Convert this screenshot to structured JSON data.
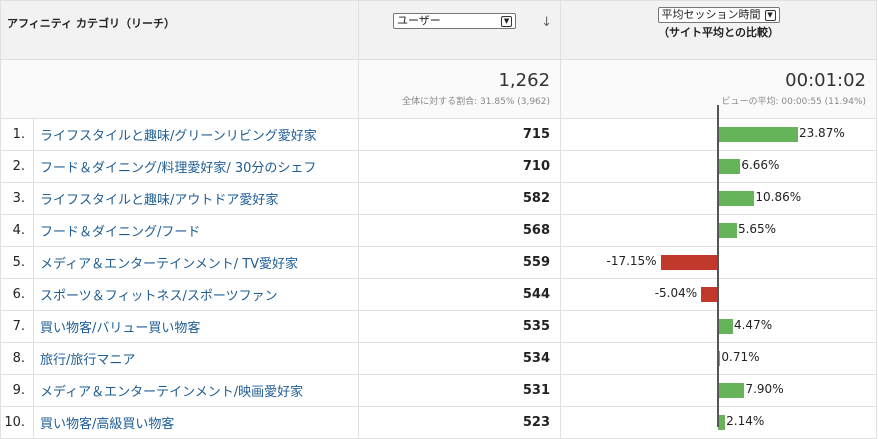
{
  "header": {
    "dimension": "アフィニティ カテゴリ（リーチ）",
    "users_select": "ユーザー",
    "sort_icon": "down-arrow-icon",
    "metric_select": "平均セッション時間",
    "compare_note": "（サイト平均との比較）"
  },
  "totals": {
    "users": "1,262",
    "users_note": "全体に対する割合: 31.85% (3,962)",
    "metric": "00:01:02",
    "metric_note": "ビューの平均: 00:00:55 (11.94%)"
  },
  "rows": [
    {
      "idx": "1.",
      "name": "ライフスタイルと趣味/グリーンリビング愛好家",
      "users": "715",
      "pct": "23.87%",
      "value": 23.87
    },
    {
      "idx": "2.",
      "name": "フード＆ダイニング/料理愛好家/ 30分のシェフ",
      "users": "710",
      "pct": "6.66%",
      "value": 6.66
    },
    {
      "idx": "3.",
      "name": "ライフスタイルと趣味/アウトドア愛好家",
      "users": "582",
      "pct": "10.86%",
      "value": 10.86
    },
    {
      "idx": "4.",
      "name": "フード＆ダイニング/フード",
      "users": "568",
      "pct": "5.65%",
      "value": 5.65
    },
    {
      "idx": "5.",
      "name": "メディア＆エンターテインメント/ TV愛好家",
      "users": "559",
      "pct": "-17.15%",
      "value": -17.15
    },
    {
      "idx": "6.",
      "name": "スポーツ＆フィットネス/スポーツファン",
      "users": "544",
      "pct": "-5.04%",
      "value": -5.04
    },
    {
      "idx": "7.",
      "name": "買い物客/バリュー買い物客",
      "users": "535",
      "pct": "4.47%",
      "value": 4.47
    },
    {
      "idx": "8.",
      "name": "旅行/旅行マニア",
      "users": "534",
      "pct": "0.71%",
      "value": 0.71
    },
    {
      "idx": "9.",
      "name": "メディア＆エンターテインメント/映画愛好家",
      "users": "531",
      "pct": "7.90%",
      "value": 7.9
    },
    {
      "idx": "10.",
      "name": "買い物客/高級買い物客",
      "users": "523",
      "pct": "2.14%",
      "value": 2.14
    }
  ],
  "colors": {
    "positive": "#66b359",
    "negative": "#c0392b",
    "link": "#1f5d95"
  }
}
